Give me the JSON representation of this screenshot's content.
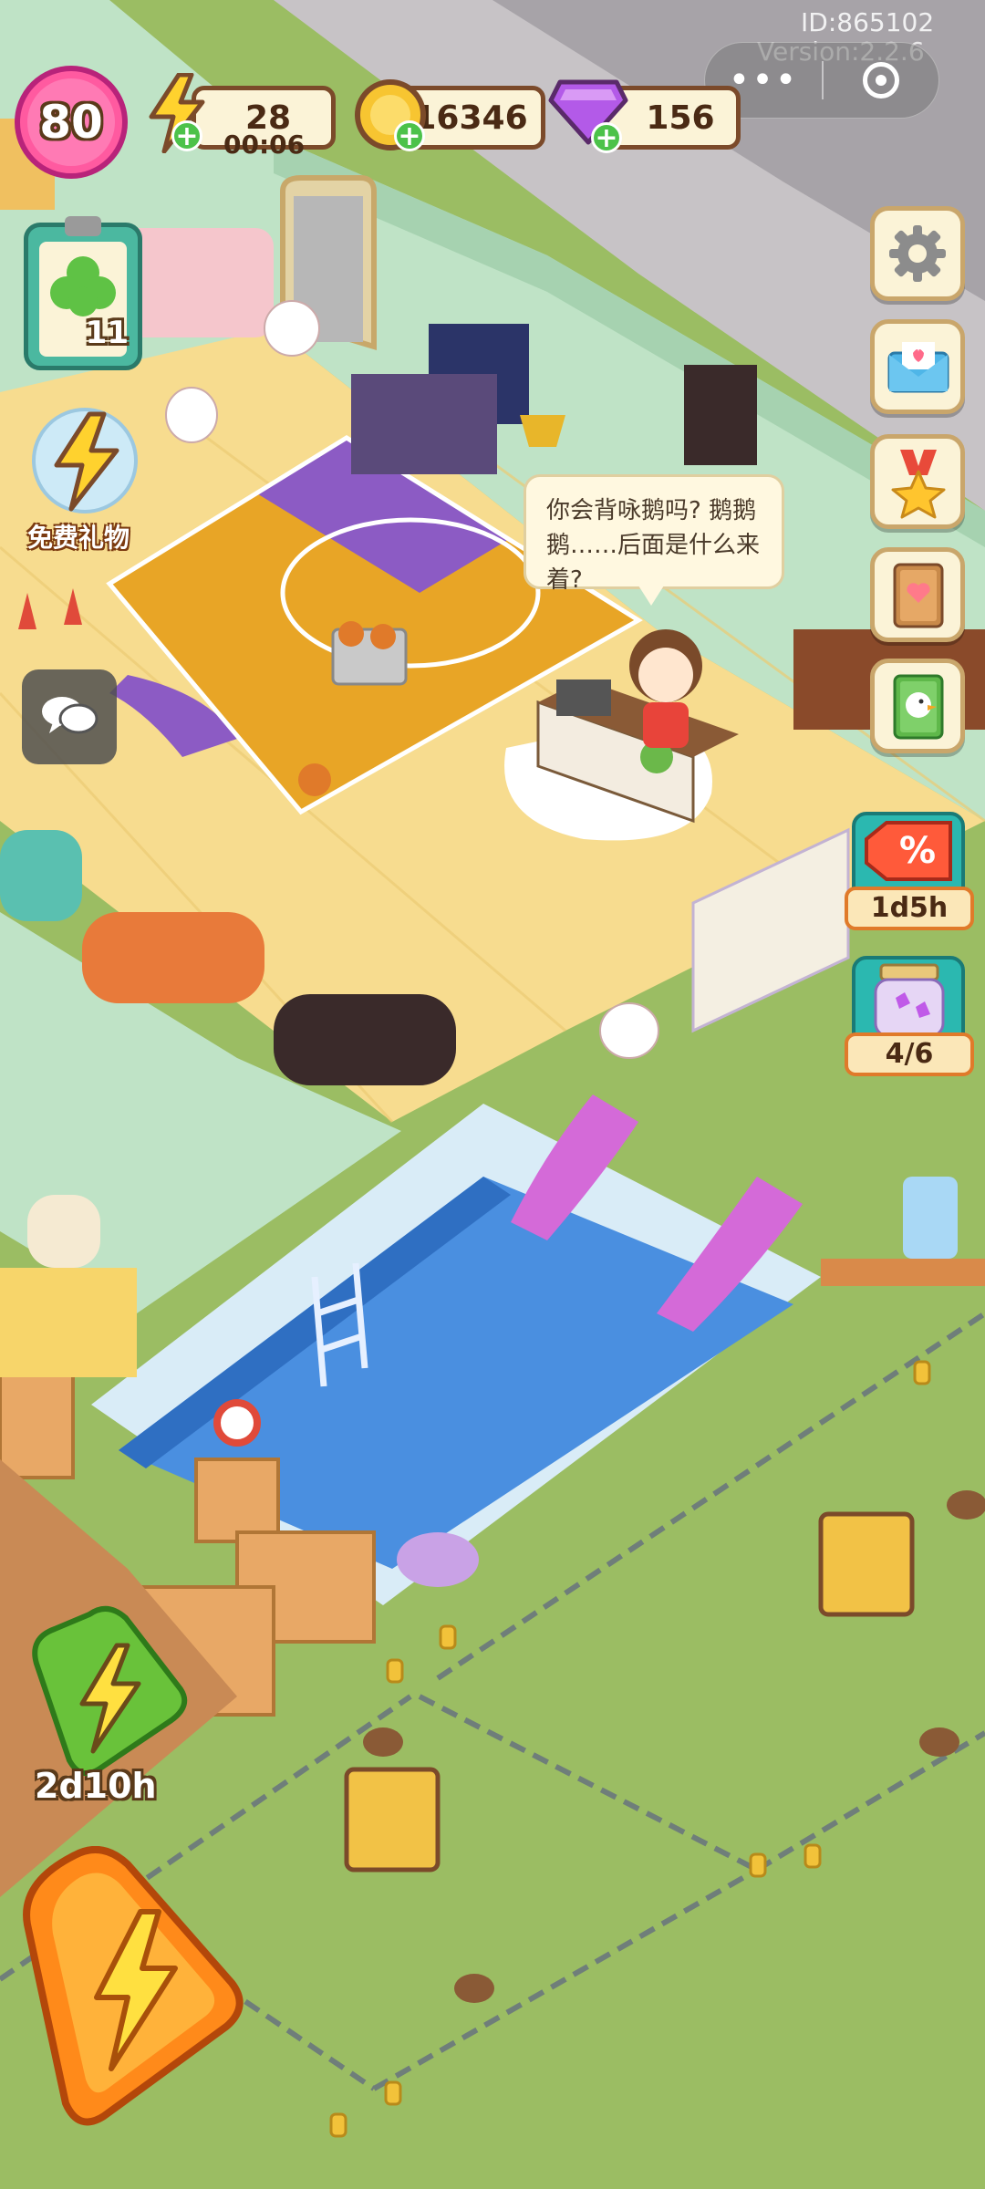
{
  "hud": {
    "level": "80",
    "energy": "28",
    "energy_timer": "00:06",
    "coins": "16346",
    "gems": "156",
    "account_id": "ID:865102",
    "version": "Version:2.2.6"
  },
  "free_gift": {
    "label": "免费礼物"
  },
  "clipboard": {
    "count": "11"
  },
  "speech_bubble": {
    "text": "你会背咏鹅吗? 鹅鹅鹅……后面是什么来着?"
  },
  "sidebar": {
    "items": [
      {
        "name": "settings",
        "icon": "gear-icon"
      },
      {
        "name": "mail",
        "icon": "envelope-icon"
      },
      {
        "name": "achievements",
        "icon": "medal-star-icon"
      },
      {
        "name": "collection-book",
        "icon": "book-icon"
      },
      {
        "name": "duck-album",
        "icon": "duck-book-icon"
      }
    ]
  },
  "offers": {
    "discount_timer": "1d5h",
    "jar_progress": "4/6"
  },
  "boost": {
    "timer": "2d10h"
  },
  "colors": {
    "wall": "#bfe3c6",
    "floor": "#f5d98a",
    "court": "#e8a526",
    "court_purple": "#8c5bc4",
    "pool_water": "#4a8fe0",
    "grass": "#9bbd63",
    "hud_border": "#7b4a2a"
  }
}
